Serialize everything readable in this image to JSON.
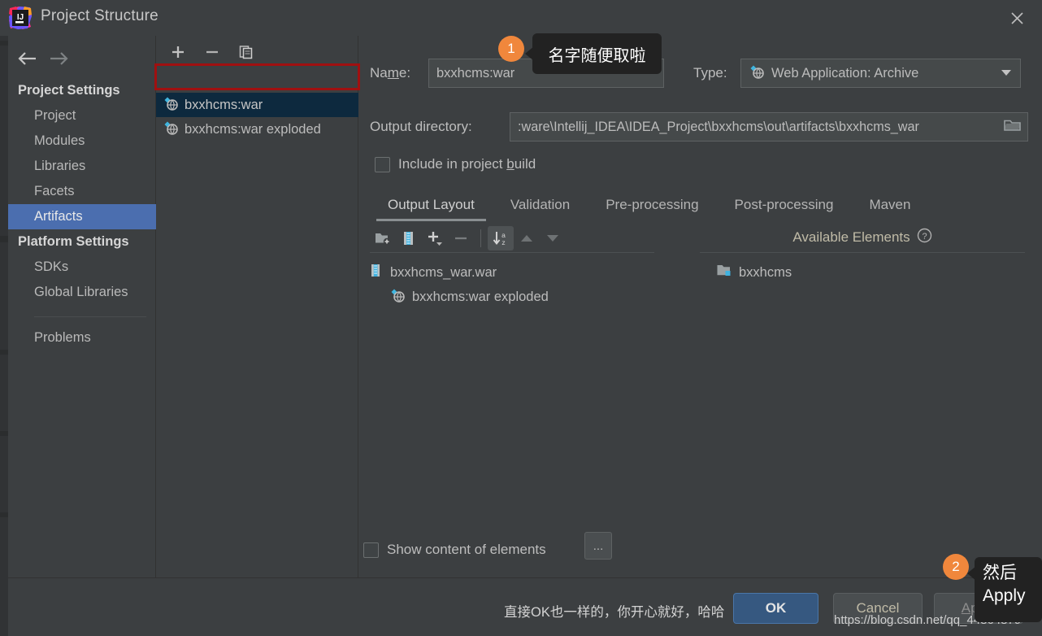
{
  "window": {
    "title": "Project Structure",
    "logo_icon": "intellij-idea-logo",
    "close_icon": "close-icon"
  },
  "nav": {
    "back_icon": "arrow-left-icon",
    "forward_icon": "arrow-right-icon"
  },
  "sidebar": {
    "groups": [
      {
        "label": "Project Settings",
        "items": [
          {
            "label": "Project",
            "selected": false
          },
          {
            "label": "Modules",
            "selected": false
          },
          {
            "label": "Libraries",
            "selected": false
          },
          {
            "label": "Facets",
            "selected": false
          },
          {
            "label": "Artifacts",
            "selected": true
          }
        ]
      },
      {
        "label": "Platform Settings",
        "items": [
          {
            "label": "SDKs",
            "selected": false
          },
          {
            "label": "Global Libraries",
            "selected": false
          }
        ]
      }
    ],
    "problems_label": "Problems",
    "help_label": "?"
  },
  "artifacts_panel": {
    "toolbar": [
      {
        "name": "add-artifact-button",
        "glyph": "+"
      },
      {
        "name": "remove-artifact-button",
        "glyph": "−"
      },
      {
        "name": "copy-artifact-button",
        "glyph": "copy-icon"
      }
    ],
    "items": [
      {
        "label": "bxxhcms:war",
        "icon": "web-archive-icon",
        "selected": true,
        "annotated": true
      },
      {
        "label": "bxxhcms:war exploded",
        "icon": "web-exploded-icon",
        "selected": false,
        "annotated": false
      }
    ]
  },
  "detail": {
    "name_label": "Na<u>m</u>e:",
    "name_value": "bxxhcms:war",
    "type_label": "Type:",
    "type_value": "Web Application: Archive",
    "type_icon": "web-archive-icon",
    "output_dir_label": "Output directory:",
    "output_dir_value": ":ware\\Intellij_IDEA\\IDEA_Project\\bxxhcms\\out\\artifacts\\bxxhcms_war",
    "browse_icon": "folder-browse-icon",
    "include_in_build_label": "Include in project <u>b</u>uild",
    "include_in_build_checked": false,
    "tabs": [
      {
        "label": "Output Layout",
        "active": true
      },
      {
        "label": "Validation",
        "active": false
      },
      {
        "label": "Pre-processing",
        "active": false
      },
      {
        "label": "Post-processing",
        "active": false
      },
      {
        "label": "Maven",
        "active": false
      }
    ],
    "tree_toolbar": [
      {
        "name": "create-directory-button",
        "icon": "folder-add-icon",
        "active": false
      },
      {
        "name": "create-archive-button",
        "icon": "archive-icon",
        "active": false
      },
      {
        "name": "add-copy-button",
        "icon": "plus-dropdown-icon",
        "active": false
      },
      {
        "name": "remove-element-button",
        "icon": "minus-icon",
        "active": false
      },
      {
        "name": "sort-alphabetically-button",
        "icon": "sort-az-icon",
        "active": true
      },
      {
        "name": "move-up-button",
        "icon": "arrow-up-icon",
        "active": false
      },
      {
        "name": "move-down-button",
        "icon": "arrow-down-icon",
        "active": false
      }
    ],
    "available_elements_label": "Available Elements",
    "available_elements_help_icon": "help-circle-icon",
    "output_tree": [
      {
        "label": "bxxhcms_war.war",
        "icon": "archive-icon",
        "indent": 0
      },
      {
        "label": "bxxhcms:war exploded",
        "icon": "web-exploded-icon",
        "indent": 1
      }
    ],
    "available_tree": [
      {
        "label": "bxxhcms",
        "icon": "module-folder-icon",
        "indent": 0
      }
    ],
    "show_content_label": "Show content of elements",
    "show_content_checked": false,
    "dots_button_label": "..."
  },
  "footer": {
    "note": "直接OK也一样的，你开心就好，哈哈",
    "ok_label": "OK",
    "cancel_label": "Cancel",
    "apply_label": "<u>A</u>pply",
    "watermark": "https://blog.csdn.net/qq_44864879"
  },
  "annotations": [
    {
      "number": "1",
      "text": "名字随便取啦"
    },
    {
      "number": "2",
      "text": "然后\nApply"
    }
  ],
  "colors": {
    "accent_blue": "#4b6eaf",
    "ok_button": "#365880",
    "annotation_orange": "#f0873c",
    "annotation_red": "#a01010",
    "selection_dark": "#0d293e"
  }
}
